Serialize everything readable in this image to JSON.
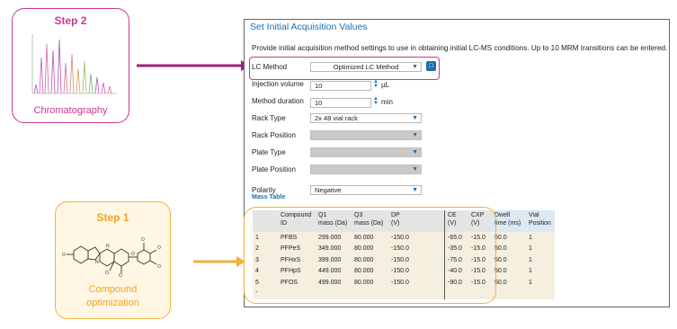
{
  "step2": {
    "title": "Step 2",
    "caption": "Chromatography"
  },
  "step1": {
    "title": "Step 1",
    "caption_line1": "Compound",
    "caption_line2": "optimization"
  },
  "panel": {
    "title": "Set Initial Acquisition Values",
    "description": "Provide initial acquisition method settings to use in obtaining initial LC-MS conditions. Up to 10 MRM transitions can be entered.",
    "lc_method": {
      "label": "LC Method",
      "value": "Optimized LC Method"
    },
    "injection_volume": {
      "label": "Injection volume",
      "value": "10",
      "unit": "µL"
    },
    "method_duration": {
      "label": "Method duration",
      "value": "10",
      "unit": "min"
    },
    "rack_type": {
      "label": "Rack Type",
      "value": "2x 48 vial rack"
    },
    "rack_position": {
      "label": "Rack Position",
      "value": ""
    },
    "plate_type": {
      "label": "Plate Type",
      "value": ""
    },
    "plate_position": {
      "label": "Plate Position",
      "value": ""
    },
    "polarity": {
      "label": "Polarity",
      "value": "Negative"
    },
    "mass_table_label": "Mass Table"
  },
  "mass_table": {
    "headers": [
      "",
      "Compound\nID",
      "Q1\nmass (Da)",
      "Q3\nmass (Da)",
      "DP\n(V)",
      "CE\n(V)",
      "CXP\n(V)",
      "Dwell\ntime (ms)",
      "Vial\nPosition"
    ],
    "rows": [
      [
        "1",
        "PFBS",
        "299.000",
        "80.000",
        "-150.0",
        "-65.0",
        "-15.0",
        "50.0",
        "1"
      ],
      [
        "2",
        "PFPeS",
        "349.000",
        "80.000",
        "-150.0",
        "-35.0",
        "-15.0",
        "50.0",
        "1"
      ],
      [
        "3",
        "PFHxS",
        "399.000",
        "80.000",
        "-150.0",
        "-75.0",
        "-15.0",
        "50.0",
        "1"
      ],
      [
        "4",
        "PFHpS",
        "449.000",
        "80.000",
        "-150.0",
        "-40.0",
        "-15.0",
        "50.0",
        "1"
      ],
      [
        "5",
        "PFOS",
        "499.000",
        "80.000",
        "-150.0",
        "-90.0",
        "-15.0",
        "50.0",
        "1"
      ]
    ],
    "new_row_marker": "*"
  },
  "colors": {
    "accent_magenta": "#c8388f",
    "accent_orange": "#f0b23a",
    "link_blue": "#1a6fb0"
  }
}
